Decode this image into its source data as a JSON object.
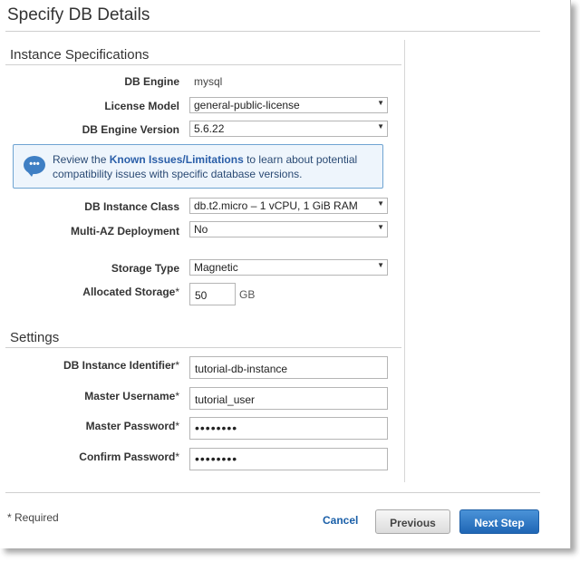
{
  "page": {
    "title": "Specify DB Details"
  },
  "instance_specs": {
    "section_title": "Instance Specifications",
    "db_engine": {
      "label": "DB Engine",
      "value": "mysql"
    },
    "license_model": {
      "label": "License Model",
      "value": "general-public-license"
    },
    "engine_version": {
      "label": "DB Engine Version",
      "value": "5.6.22"
    },
    "info": {
      "prefix": "Review the",
      "link": "Known Issues/Limitations",
      "suffix": "to learn about potential compatibility issues with specific database versions."
    },
    "instance_class": {
      "label": "DB Instance Class",
      "value": "db.t2.micro – 1 vCPU, 1 GiB RAM"
    },
    "multi_az": {
      "label": "Multi-AZ Deployment",
      "value": "No"
    },
    "storage_type": {
      "label": "Storage Type",
      "value": "Magnetic"
    },
    "allocated_storage": {
      "label": "Allocated Storage",
      "value": "50",
      "unit": "GB"
    }
  },
  "settings": {
    "section_title": "Settings",
    "identifier": {
      "label": "DB Instance Identifier",
      "value": "tutorial-db-instance"
    },
    "master_username": {
      "label": "Master Username",
      "value": "tutorial_user"
    },
    "master_password": {
      "label": "Master Password",
      "value": "••••••••"
    },
    "confirm_password": {
      "label": "Confirm Password",
      "value": "••••••••"
    }
  },
  "footer": {
    "required_note": "* Required",
    "cancel_label": "Cancel",
    "previous_label": "Previous",
    "next_label": "Next Step"
  },
  "icons": {
    "info": "chat-bubble-info-icon",
    "dropdown": "dropdown-arrow-icon"
  },
  "colors": {
    "primary_button": "#1f66b5",
    "link": "#1a5fa8",
    "info_border": "#6fa4d2"
  }
}
